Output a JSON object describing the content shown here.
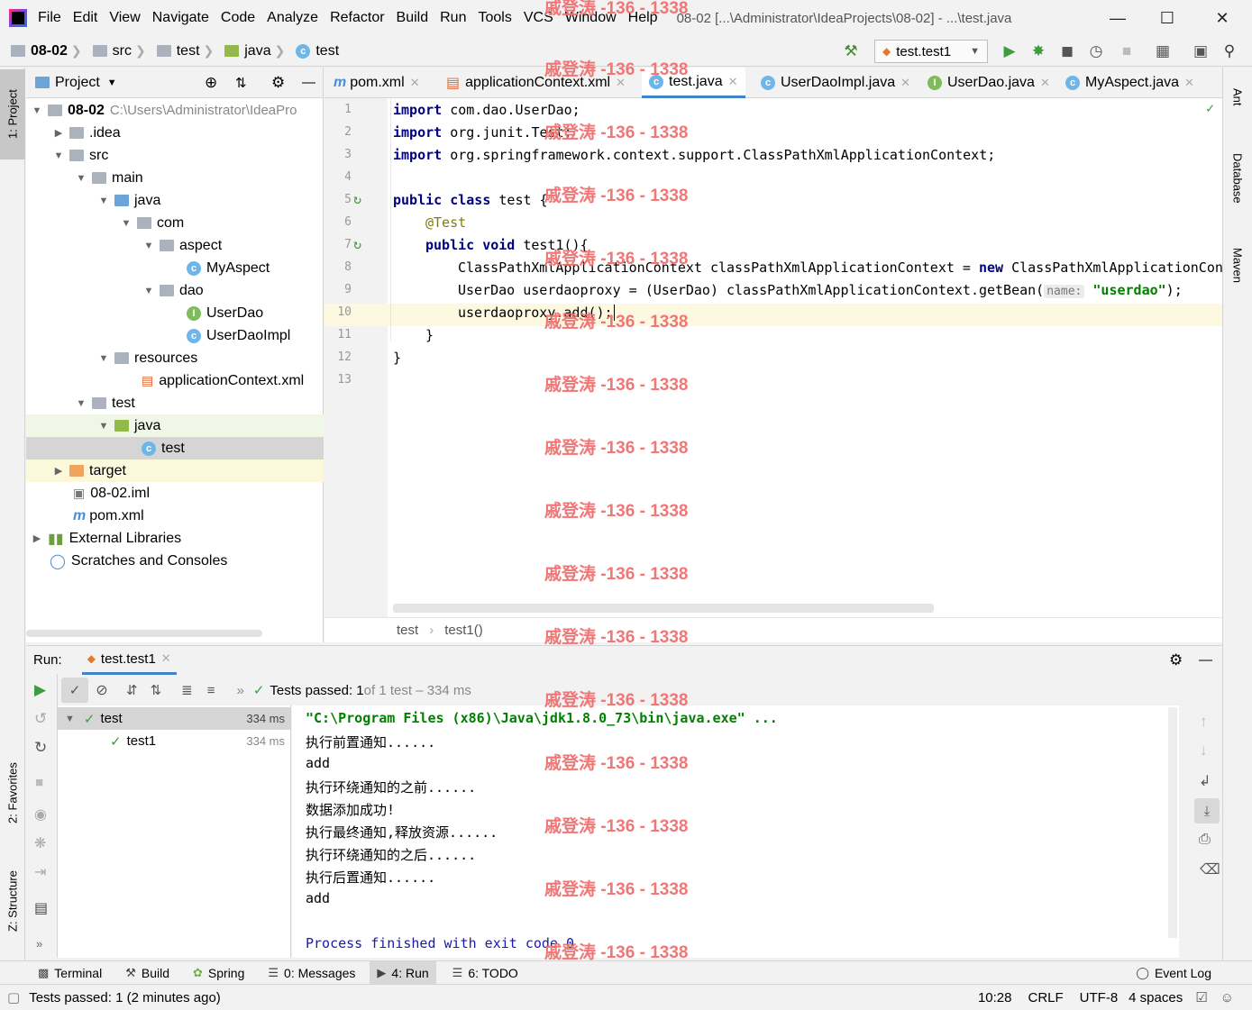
{
  "menu": {
    "items": [
      "File",
      "Edit",
      "View",
      "Navigate",
      "Code",
      "Analyze",
      "Refactor",
      "Build",
      "Run",
      "Tools",
      "VCS",
      "Window",
      "Help"
    ],
    "window_title": "08-02 [...\\Administrator\\IdeaProjects\\08-02] - ...\\test.java"
  },
  "navbar": {
    "crumbs": [
      "08-02",
      "src",
      "test",
      "java",
      "test"
    ],
    "run_config": "test.test1"
  },
  "left_strip": {
    "project": "1: Project",
    "favorites": "2: Favorites",
    "structure": "Z: Structure"
  },
  "right_strip": {
    "ant": "Ant",
    "database": "Database",
    "maven": "Maven"
  },
  "project": {
    "header": "Project",
    "root_name": "08-02",
    "root_path": "C:\\Users\\Administrator\\IdeaPro",
    "items": [
      ".idea",
      "src",
      "main",
      "java",
      "com",
      "aspect",
      "MyAspect",
      "dao",
      "UserDao",
      "UserDaoImpl",
      "resources",
      "applicationContext.xml",
      "test",
      "java",
      "test",
      "target",
      "08-02.iml",
      "pom.xml",
      "External Libraries",
      "Scratches and Consoles"
    ]
  },
  "editor": {
    "tabs": [
      "pom.xml",
      "applicationContext.xml",
      "test.java",
      "UserDaoImpl.java",
      "UserDao.java",
      "MyAspect.java"
    ],
    "line_numbers": [
      "1",
      "2",
      "3",
      "4",
      "5",
      "6",
      "7",
      "8",
      "9",
      "10",
      "11",
      "12",
      "13"
    ],
    "code": {
      "l1_kw": "import",
      "l1": " com.dao.UserDao;",
      "l2_kw": "import",
      "l2": " org.junit.Test;",
      "l3_kw": "import",
      "l3": " org.springframework.context.support.ClassPathXmlApplicationContext;",
      "l5_kw": "public class",
      "l5": " test {",
      "l6": "@Test",
      "l7_kw": "public void",
      "l7": " test1(){",
      "l8": "ClassPathXmlApplicationContext classPathXmlApplicationContext = ",
      "l8_kw": "new",
      "l8_tail": " ClassPathXmlApplicationContext(",
      "l9": "UserDao userdaoproxy = (UserDao) classPathXmlApplicationContext.getBean(",
      "l9_hint": "name:",
      "l9_str": "\"userdao\"",
      "l9_tail": ");",
      "l10": "userdaoproxy.add();",
      "l11": "}",
      "l12": "}"
    },
    "breadcrumbs": [
      "test",
      "test1()"
    ]
  },
  "run": {
    "label": "Run:",
    "tab": "test.test1",
    "status_prefix": "Tests passed: 1",
    "status_suffix": " of 1 test – 334 ms",
    "tree": [
      {
        "name": "test",
        "time": "334 ms"
      },
      {
        "name": "test1",
        "time": "334 ms"
      }
    ],
    "console": [
      "\"C:\\Program Files (x86)\\Java\\jdk1.8.0_73\\bin\\java.exe\" ...",
      "执行前置通知......",
      "add",
      "执行环绕通知的之前......",
      "数据添加成功!",
      "执行最终通知,释放资源......",
      "执行环绕通知的之后......",
      "执行后置通知......",
      "add",
      "",
      "Process finished with exit code 0"
    ]
  },
  "tool_tabs": [
    "Terminal",
    "Build",
    "Spring",
    "0: Messages",
    "4: Run",
    "6: TODO"
  ],
  "event_log": "Event Log",
  "status": {
    "message": "Tests passed: 1 (2 minutes ago)",
    "position": "10:28",
    "line_sep": "CRLF",
    "encoding": "UTF-8",
    "indent": "4 spaces"
  },
  "watermark": "戚登涛 -136 - 1338"
}
